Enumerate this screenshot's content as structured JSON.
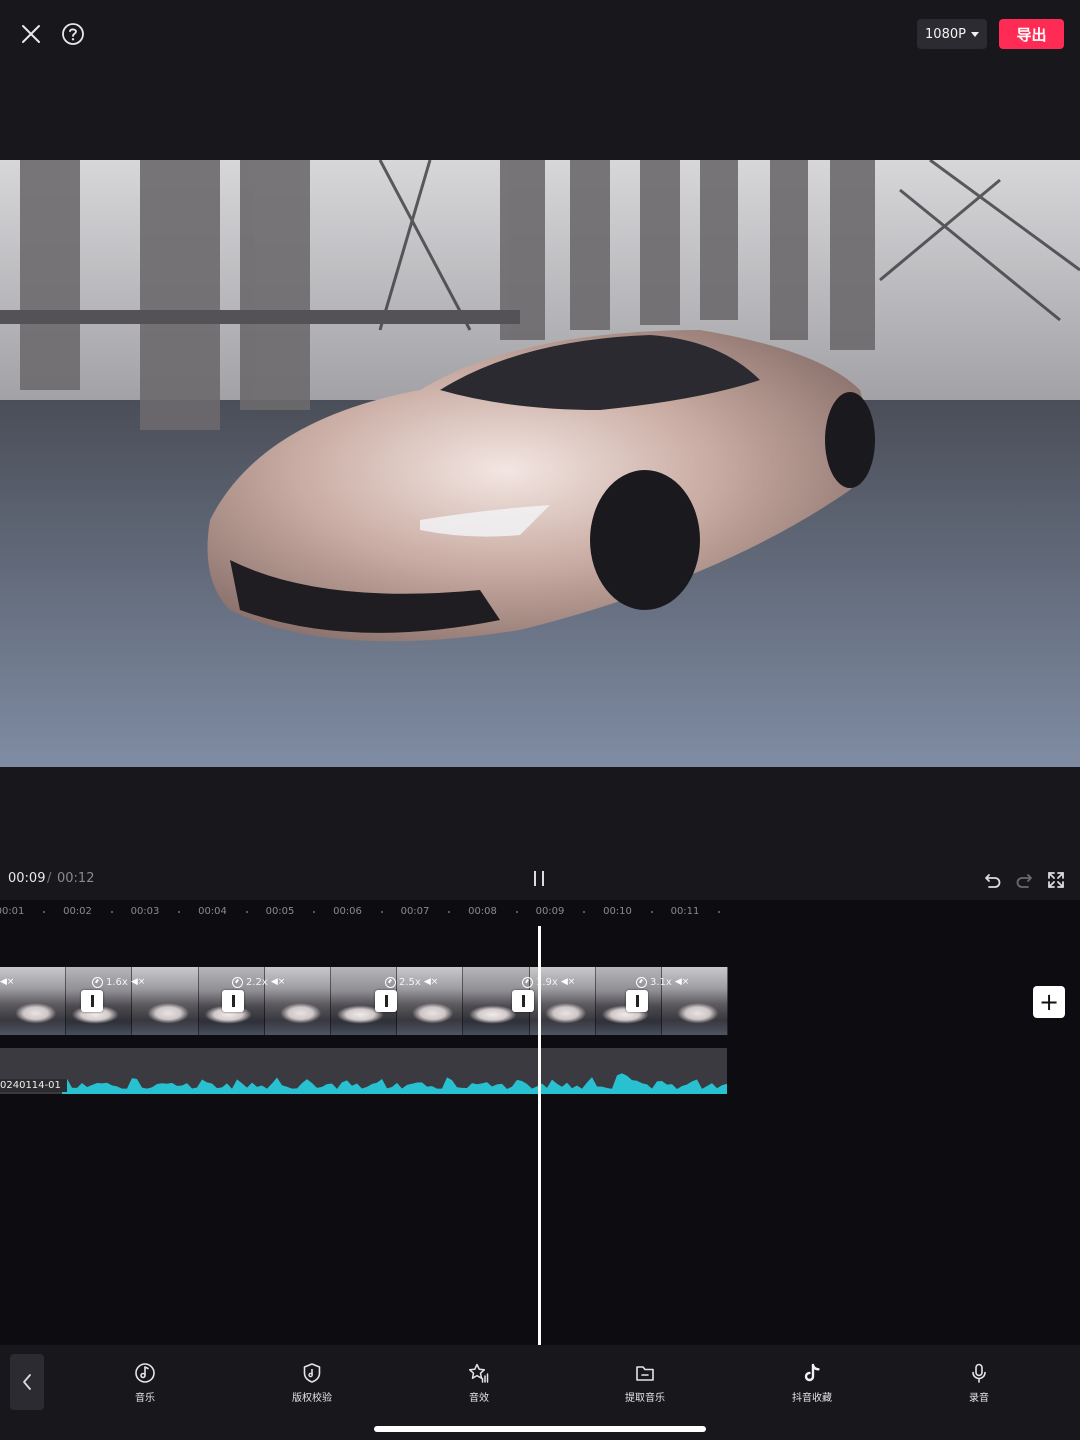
{
  "header": {
    "resolution": "1080P",
    "export_label": "导出",
    "icons": [
      "close-icon",
      "help-icon",
      "caret-down-icon"
    ],
    "accent_color": "#fe2c55"
  },
  "player": {
    "current_time": "00:09",
    "separator": "/",
    "total_time": "00:12",
    "icons": [
      "pause-icon",
      "undo-icon",
      "redo-icon",
      "fullscreen-icon"
    ]
  },
  "timeline": {
    "ruler": [
      "00:01",
      "00:02",
      "00:03",
      "00:04",
      "00:05",
      "00:06",
      "00:07",
      "00:08",
      "00:09",
      "00:10",
      "00:11"
    ],
    "clips": [
      {
        "speed": ""
      },
      {
        "speed": "1.6x"
      },
      {
        "speed": "2.2x"
      },
      {
        "speed": "2.5x"
      },
      {
        "speed": "1.9x"
      },
      {
        "speed": "3.1x"
      }
    ],
    "audio_track_name": "0240114-01",
    "audio_color": "#27c1d2",
    "add_icon": "plus-icon"
  },
  "toolbar": {
    "back_icon": "chevron-left-icon",
    "items": [
      {
        "label": "音乐",
        "icon": "music-icon"
      },
      {
        "label": "版权校验",
        "icon": "shield-icon"
      },
      {
        "label": "音效",
        "icon": "sound-effect-icon"
      },
      {
        "label": "提取音乐",
        "icon": "folder-icon"
      },
      {
        "label": "抖音收藏",
        "icon": "tiktok-icon"
      },
      {
        "label": "录音",
        "icon": "microphone-icon"
      }
    ]
  }
}
